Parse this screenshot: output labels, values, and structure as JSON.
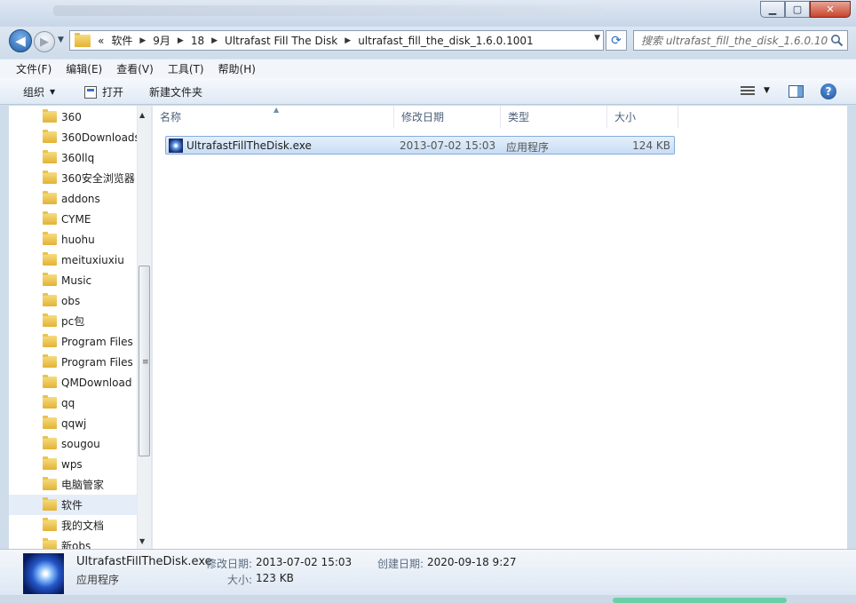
{
  "address": {
    "crumbs": [
      "«",
      "软件",
      "9月",
      "18",
      "Ultrafast Fill The Disk",
      "ultrafast_fill_the_disk_1.6.0.1001"
    ]
  },
  "search": {
    "placeholder": "搜索 ultrafast_fill_the_disk_1.6.0.1001"
  },
  "menu": [
    "文件(F)",
    "编辑(E)",
    "查看(V)",
    "工具(T)",
    "帮助(H)"
  ],
  "toolbar": {
    "organize": "组织",
    "open": "打开",
    "new_folder": "新建文件夹"
  },
  "nav": {
    "items": [
      "360",
      "360Downloads",
      "360llq",
      "360安全浏览器",
      "addons",
      "CYME",
      "huohu",
      "meituxiuxiu",
      "Music",
      "obs",
      "pc包",
      "Program Files",
      "Program Files",
      "QMDownload",
      "qq",
      "qqwj",
      "sougou",
      "wps",
      "电脑管家",
      "软件",
      "我的文档",
      "新obs"
    ],
    "selected_index": 19
  },
  "columns": {
    "name": "名称",
    "modified": "修改日期",
    "type": "类型",
    "size": "大小"
  },
  "files": [
    {
      "name": "UltrafastFillTheDisk.exe",
      "modified": "2013-07-02 15:03",
      "type": "应用程序",
      "size": "124 KB"
    }
  ],
  "details": {
    "name": "UltrafastFillTheDisk.exe",
    "type": "应用程序",
    "modified_label": "修改日期:",
    "modified": "2013-07-02 15:03",
    "created_label": "创建日期:",
    "created": "2020-09-18 9:27",
    "size_label": "大小:",
    "size": "123 KB"
  },
  "icons": {
    "back": "back-arrow-icon",
    "forward": "forward-arrow-icon",
    "refresh": "refresh-icon",
    "search": "search-icon",
    "folder": "folder-icon",
    "exe": "application-icon",
    "view": "view-list-icon",
    "preview_pane": "preview-pane-icon",
    "help": "help-icon"
  },
  "colors": {
    "accent": "#1d5ea8",
    "folder": "#e3b236",
    "selection": "#c7ddf4",
    "selection_border": "#84acdd"
  }
}
